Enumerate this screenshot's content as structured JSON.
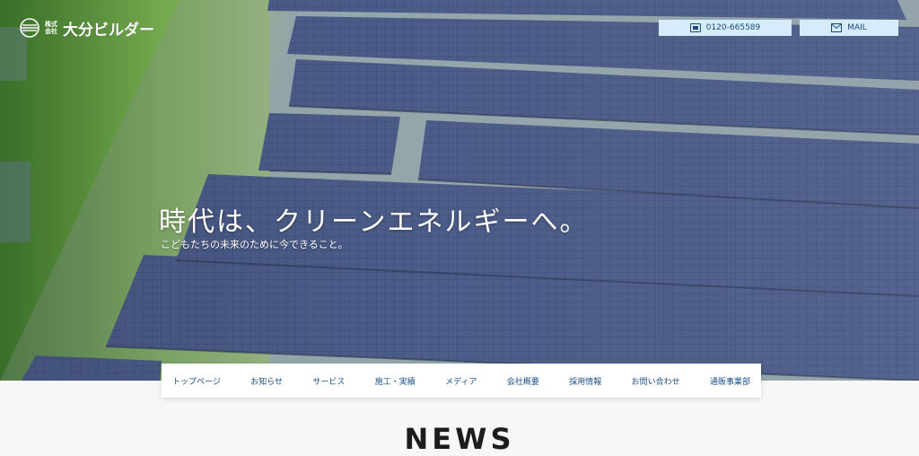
{
  "header": {
    "logo_small": "株式会社",
    "logo_text": "大分ビルダー",
    "phone_label": "0120-665589",
    "mail_label": "MAIL"
  },
  "hero": {
    "title": "時代は、クリーンエネルギーへ。",
    "subtitle": "こどもたちの未来のために今できること。"
  },
  "nav": {
    "items": [
      "トップページ",
      "お知らせ",
      "サービス",
      "施工・実績",
      "メディア",
      "会社概要",
      "採用情報",
      "お問い合わせ",
      "通販事業部"
    ]
  },
  "news": {
    "heading": "NEWS"
  },
  "icons": {
    "logo": "logo-mark-icon",
    "phone": "phone-icon",
    "mail": "mail-icon"
  },
  "colors": {
    "nav_text": "#1b4f86",
    "contact_bg": "#d6ecfb",
    "panel": "#3f4f78",
    "vegetation": "#6fa84a"
  }
}
